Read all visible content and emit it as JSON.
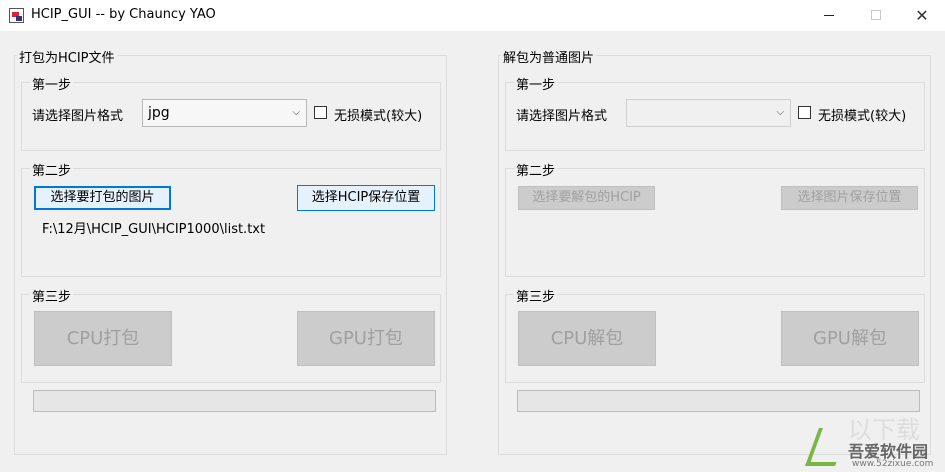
{
  "window": {
    "title": "HCIP_GUI -- by Chauncy YAO",
    "minimize_glyph": "",
    "close_glyph": "✕"
  },
  "pack": {
    "title": "打包为HCIP文件",
    "step1": {
      "title": "第一步",
      "format_label": "请选择图片格式",
      "format_value": "jpg",
      "lossless_label": "无损模式(较大)"
    },
    "step2": {
      "title": "第二步",
      "select_images_label": "选择要打包的图片",
      "select_save_label": "选择HCIP保存位置",
      "path": "F:\\12月\\HCIP_GUI\\HCIP1000\\list.txt"
    },
    "step3": {
      "title": "第三步",
      "cpu_label": "CPU打包",
      "gpu_label": "GPU打包"
    },
    "progress": 0
  },
  "unpack": {
    "title": "解包为普通图片",
    "step1": {
      "title": "第一步",
      "format_label": "请选择图片格式",
      "format_value": "",
      "lossless_label": "无损模式(较大)"
    },
    "step2": {
      "title": "第二步",
      "select_hcip_label": "选择要解包的HCIP",
      "select_save_label": "选择图片保存位置"
    },
    "step3": {
      "title": "第三步",
      "cpu_label": "CPU解包",
      "gpu_label": "GPU解包"
    },
    "progress": 0
  },
  "watermark": {
    "deco": "以下载",
    "name": "吾爱软件园",
    "url": "www.52zixue.com"
  },
  "icons": {
    "app": "app-icon",
    "dropdown": "chevron-down-icon"
  }
}
